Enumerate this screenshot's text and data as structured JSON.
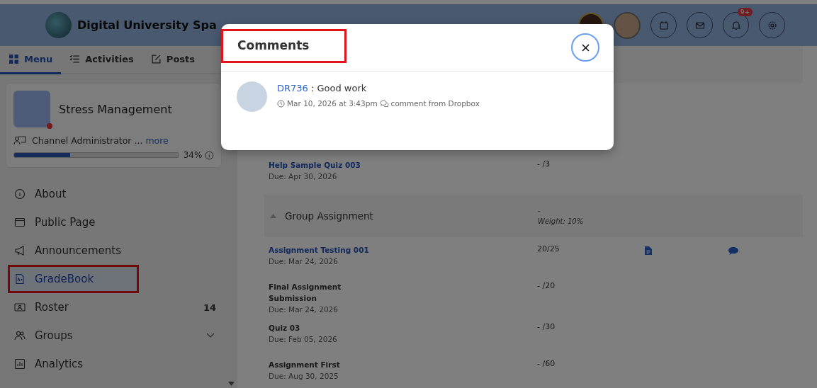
{
  "header": {
    "title": "Digital University Spa",
    "notification_badge": "9+"
  },
  "sidebar": {
    "tabs": [
      {
        "label": "Menu",
        "selected": true
      },
      {
        "label": "Activities",
        "selected": false
      },
      {
        "label": "Posts",
        "selected": false
      }
    ],
    "channel": {
      "name": "Stress Management",
      "role": "Channel Administrator ...",
      "more": "more",
      "online": true,
      "progress": {
        "level": 0.34,
        "reading": "34%"
      }
    },
    "menu": [
      {
        "label": "About",
        "selected": false,
        "highlighted": false
      },
      {
        "label": "Public Page",
        "selected": false,
        "highlighted": false
      },
      {
        "label": "Announcements",
        "selected": false,
        "highlighted": false
      },
      {
        "label": "GradeBook",
        "selected": true,
        "highlighted": true
      },
      {
        "label": "Roster",
        "selected": false,
        "highlighted": false,
        "count": "14"
      },
      {
        "label": "Groups",
        "selected": false,
        "highlighted": false,
        "expandable": true
      },
      {
        "label": "Analytics",
        "selected": false,
        "highlighted": false
      }
    ]
  },
  "gradebook": {
    "rows": [
      {
        "kind": "item",
        "title": "Help Sample Quiz 003",
        "link": true,
        "due": "Due: Apr 30, 2026",
        "score": "- /3",
        "has_file": false,
        "has_comment": false
      },
      {
        "kind": "group",
        "title": "Group Assignment",
        "score": "-",
        "weight": "Weight: 10%",
        "expanded": true
      },
      {
        "kind": "item",
        "title": "Assignment Testing 001",
        "link": true,
        "due": "Due: Mar 24, 2026",
        "score": "20/25",
        "has_file": true,
        "has_comment": true
      },
      {
        "kind": "item",
        "title": "Final Assignment Submission",
        "link": false,
        "due": "Due: Mar 24, 2026",
        "score": "- /20",
        "has_file": false,
        "has_comment": false
      },
      {
        "kind": "item",
        "title": "Quiz 03",
        "link": false,
        "due": "Due: Feb 05, 2026",
        "score": "- /30",
        "has_file": false,
        "has_comment": false
      },
      {
        "kind": "item",
        "title": "Assignment First",
        "link": false,
        "due": "Due: Aug 30, 2025",
        "score": "- /60",
        "has_file": false,
        "has_comment": false
      }
    ]
  },
  "modal": {
    "title": "Comments",
    "title_highlighted": true,
    "comments": [
      {
        "author": "DR736",
        "text": ": Good work",
        "time": "Mar 10, 2026 at 3:43pm",
        "source": "comment from Dropbox"
      }
    ]
  }
}
